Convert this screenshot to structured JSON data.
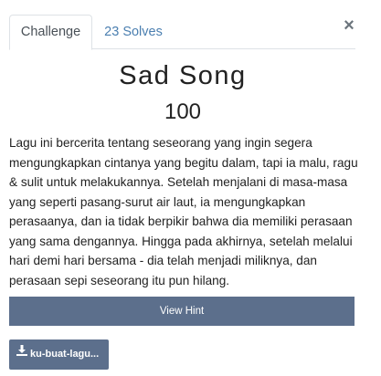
{
  "tabs": [
    {
      "label": "Challenge",
      "active": true
    },
    {
      "label": "23 Solves",
      "active": false
    }
  ],
  "close_icon": "×",
  "challenge": {
    "name": "Sad Song",
    "points": "100",
    "description": "Lagu ini bercerita tentang seseorang yang ingin segera mengungkapkan cintanya yang begitu dalam, tapi ia malu, ragu & sulit untuk melakukannya. Setelah menjalani di masa-masa yang seperti pasang-surut air laut, ia mengungkapkan perasaanya, dan ia tidak berpikir bahwa dia memiliki perasaan yang sama dengannya. Hingga pada akhirnya, setelah melalui hari demi hari bersama - dia telah menjadi miliknya, dan perasaan sepi seseorang itu pun hilang."
  },
  "buttons": {
    "hint_label": "View Hint",
    "file_label": "ku-buat-lagu..."
  },
  "icons": {
    "close": "close-icon",
    "file": "download-icon"
  },
  "colors": {
    "button_bg": "#5c6f8c",
    "tab_link": "#4b7fb0"
  }
}
